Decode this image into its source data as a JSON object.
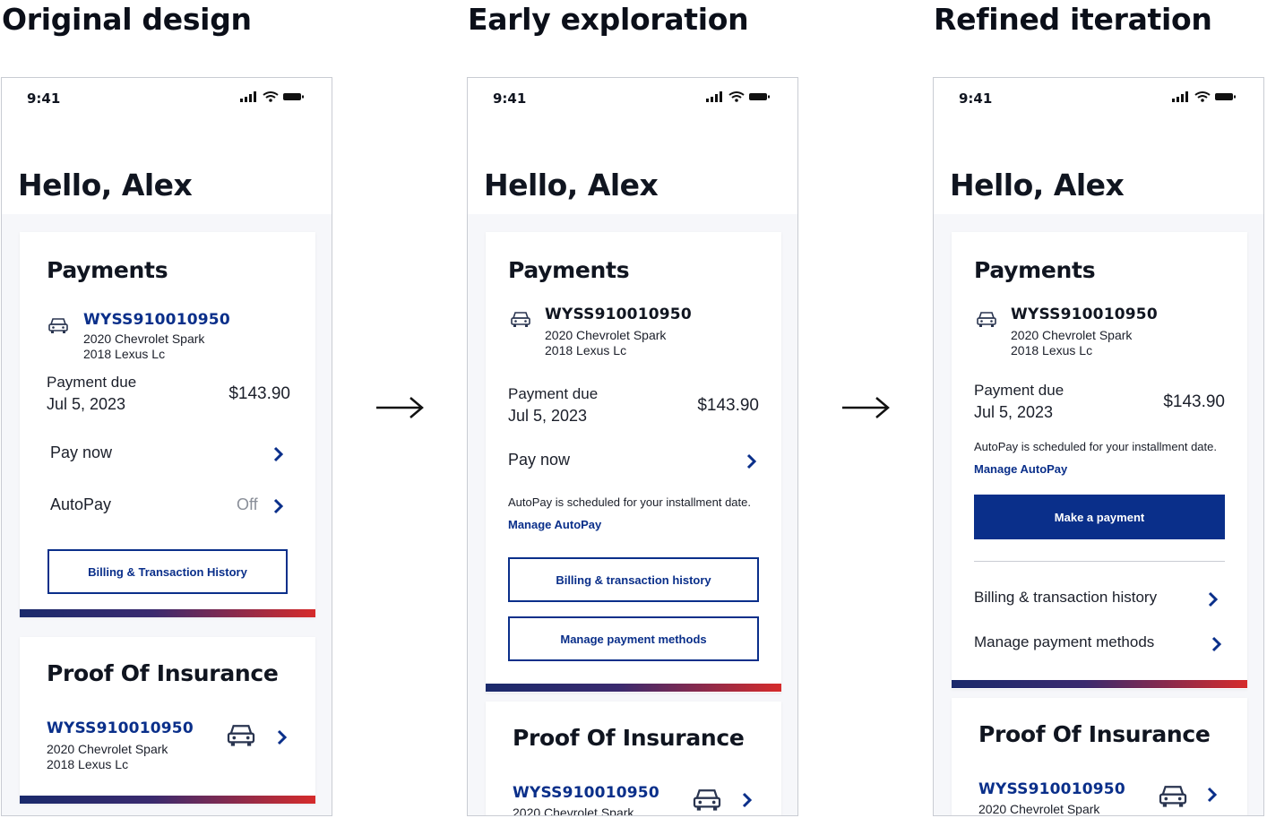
{
  "columns": [
    {
      "title": "Original design"
    },
    {
      "title": "Early exploration"
    },
    {
      "title": "Refined iteration"
    }
  ],
  "phone": {
    "time": "9:41",
    "greeting": "Hello, Alex"
  },
  "payments": {
    "title": "Payments",
    "vin": "WYSS910010950",
    "vehicle1": "2020 Chevrolet Spark",
    "vehicle2": "2018 Lexus Lc",
    "due_label": "Payment due",
    "due_date": "Jul 5, 2023",
    "amount": "$143.90",
    "pay_now": "Pay now",
    "autopay": "AutoPay",
    "autopay_status": "Off",
    "autopay_note": "AutoPay is scheduled for your installment date.",
    "manage_autopay": "Manage AutoPay",
    "billing_btn_v1": "Billing & Transaction History",
    "billing_btn_v2": "Billing & transaction history",
    "manage_methods": "Manage payment methods",
    "make_payment": "Make a payment"
  },
  "insurance": {
    "title": "Proof Of Insurance",
    "vin": "WYSS910010950",
    "vehicle1": "2020 Chevrolet Spark",
    "vehicle2": "2018 Lexus Lc"
  },
  "colors": {
    "brand_blue": "#0a2f8a",
    "gradient_start": "#1a2a6c",
    "gradient_end": "#d62b2b"
  }
}
